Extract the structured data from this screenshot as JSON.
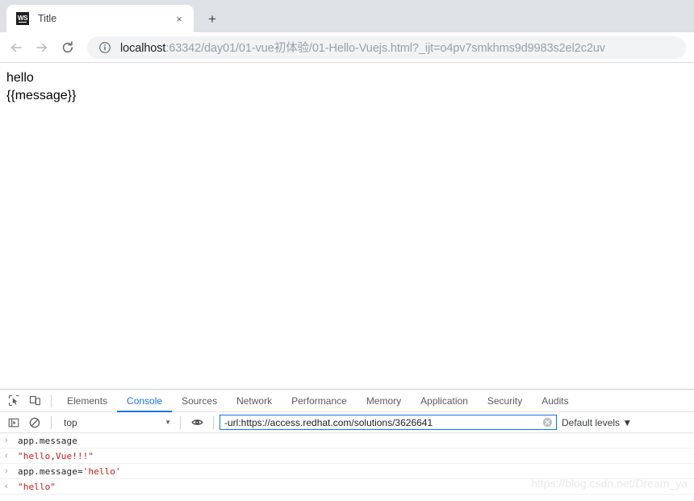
{
  "browser": {
    "tab": {
      "favicon_text": "WS",
      "favicon_name": "webstorm-favicon",
      "title": "Title",
      "close_label": "×"
    },
    "new_tab_label": "+",
    "toolbar": {
      "back_icon": "arrow-left-icon",
      "forward_icon": "arrow-right-icon",
      "reload_icon": "reload-icon",
      "info_icon": "info-circle-icon",
      "url_host": "localhost",
      "url_rest": ":63342/day01/01-vue初体验/01-Hello-Vuejs.html?_ijt=o4pv7smkhms9d9983s2el2c2uv",
      "url_full": "localhost:63342/day01/01-vue初体验/01-Hello-Vuejs.html?_ijt=o4pv7smkhms9d9983s2el2c2uv"
    }
  },
  "page": {
    "lines": [
      "hello",
      "{{message}}"
    ]
  },
  "devtools": {
    "inspect_icon": "inspect-element-icon",
    "device_icon": "device-toolbar-icon",
    "tabs": [
      {
        "label": "Elements",
        "active": false
      },
      {
        "label": "Console",
        "active": true
      },
      {
        "label": "Sources",
        "active": false
      },
      {
        "label": "Network",
        "active": false
      },
      {
        "label": "Performance",
        "active": false
      },
      {
        "label": "Memory",
        "active": false
      },
      {
        "label": "Application",
        "active": false
      },
      {
        "label": "Security",
        "active": false
      },
      {
        "label": "Audits",
        "active": false
      }
    ],
    "console_toolbar": {
      "sidebar_icon": "console-sidebar-icon",
      "clear_icon": "clear-console-icon",
      "context_value": "top",
      "context_arrow": "▼",
      "eye_icon": "live-expression-eye-icon",
      "filter_value": "-url:https://access.redhat.com/solutions/3626641",
      "filter_placeholder": "Filter",
      "clear_filter_icon": "clear-filter-icon",
      "levels_label": "Default levels ▼"
    },
    "messages": [
      {
        "marker": "›",
        "kind": "input",
        "code": "app.message",
        "code_str": ""
      },
      {
        "marker": "‹",
        "kind": "output",
        "code": "",
        "code_str": "\"hello,Vue!!!\""
      },
      {
        "marker": "›",
        "kind": "input",
        "code": "app.message=",
        "code_str": "'hello'"
      },
      {
        "marker": "‹",
        "kind": "output",
        "code": "",
        "code_str": "\"hello\""
      }
    ]
  },
  "watermark": "https://blog.csdn.net/Dream_ya",
  "colors": {
    "accent_blue": "#1a73e8",
    "tabstrip_bg": "#dee1e6",
    "string_red": "#c41a16"
  }
}
